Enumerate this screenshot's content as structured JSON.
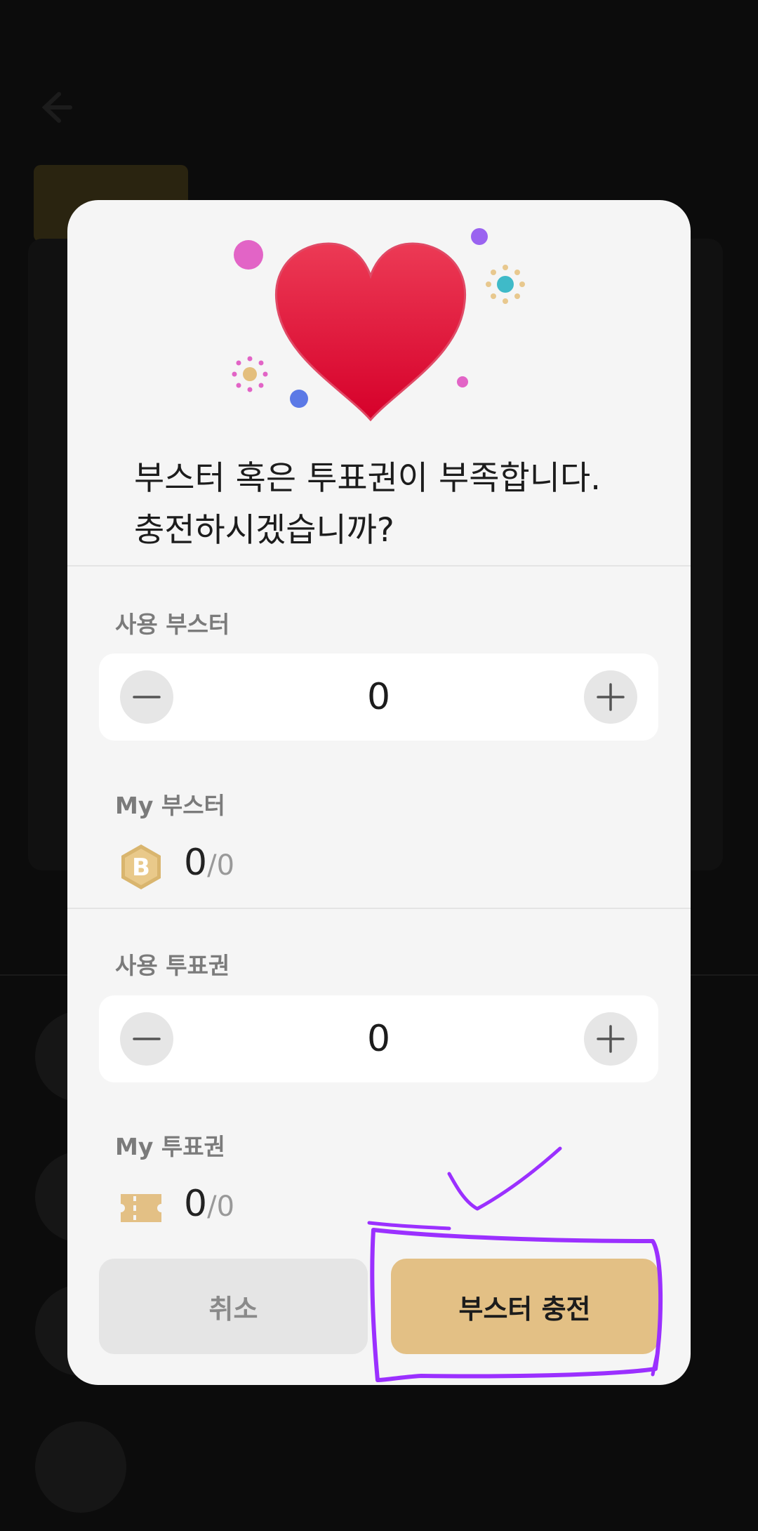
{
  "dialog": {
    "title_line1": "부스터 혹은 투표권이 부족합니다.",
    "title_line2": "충전하시겠습니까?",
    "booster_use": {
      "label": "사용 부스터",
      "value": "0"
    },
    "my_booster": {
      "label": "My 부스터",
      "icon_letter": "B",
      "current": "0",
      "total": "/0"
    },
    "vote_use": {
      "label": "사용 투표권",
      "value": "0"
    },
    "my_vote": {
      "label": "My 투표권",
      "current": "0",
      "total": "/0"
    },
    "cancel_label": "취소",
    "charge_label": "부스터 충전"
  },
  "colors": {
    "accent": "#e3c085",
    "heart": "#e0233f",
    "annotation": "#9b30ff",
    "overlay": "#000000"
  },
  "icons": {
    "back": "arrow-left-icon",
    "minus": "minus-icon",
    "plus": "plus-icon",
    "booster": "booster-coin-icon",
    "ticket": "ticket-icon",
    "hero": "heart-icon"
  }
}
